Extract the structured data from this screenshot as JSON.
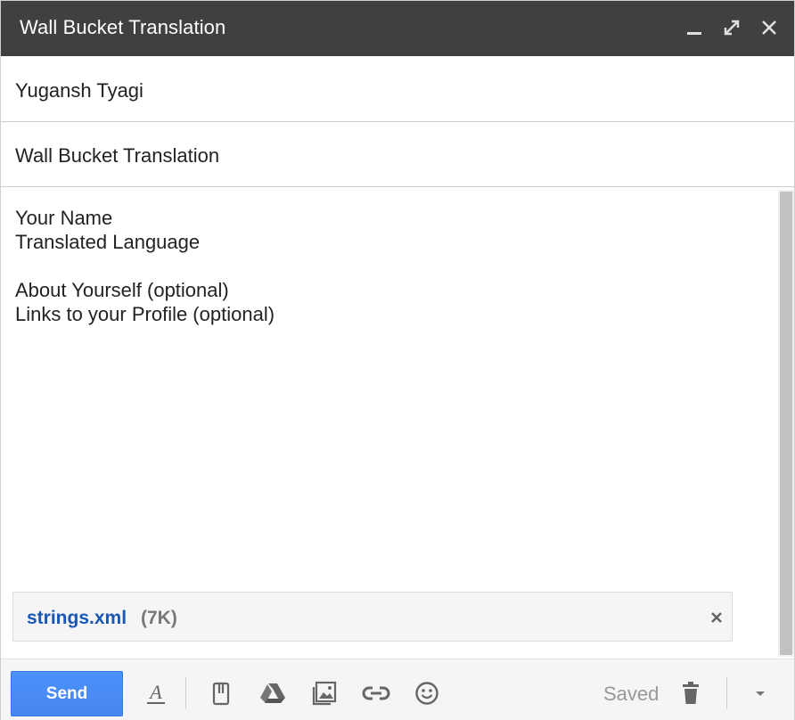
{
  "window": {
    "title": "Wall Bucket Translation",
    "controls": [
      "minimize-icon",
      "pop-out-icon",
      "close-icon"
    ]
  },
  "fields": {
    "to": "Yugansh Tyagi",
    "subject": "Wall Bucket Translation"
  },
  "body": {
    "lines": [
      "Your Name",
      "Translated Language",
      "",
      "About Yourself (optional)",
      "Links to your Profile (optional)"
    ]
  },
  "attachment": {
    "filename": "strings.xml",
    "size": "(7K)"
  },
  "toolbar": {
    "send_label": "Send",
    "status": "Saved",
    "icons": [
      "text-format-icon",
      "attach-icon",
      "drive-icon",
      "photo-icon",
      "link-icon",
      "emoji-icon",
      "trash-icon",
      "more-options-icon"
    ]
  },
  "colors": {
    "titlebar_bg": "#404040",
    "send_bg": "#4d90fe",
    "attachment_name": "#1a57b5"
  }
}
